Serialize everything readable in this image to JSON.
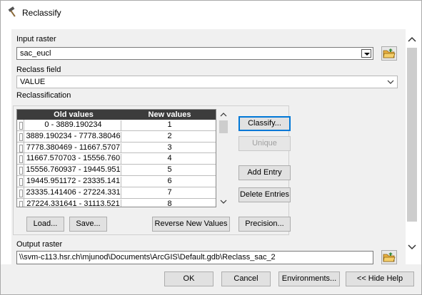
{
  "window": {
    "title": "Reclassify"
  },
  "input_raster": {
    "label": "Input raster",
    "value": "sac_eucl"
  },
  "reclass_field": {
    "label": "Reclass field",
    "value": "VALUE"
  },
  "reclassification": {
    "label": "Reclassification",
    "columns": [
      "Old values",
      "New values"
    ],
    "rows": [
      {
        "old": "0 - 3889.190234",
        "new": "1"
      },
      {
        "old": "3889.190234 - 7778.38046",
        "new": "2"
      },
      {
        "old": "7778.380469 - 11667.5707",
        "new": "3"
      },
      {
        "old": "11667.570703 - 15556.760",
        "new": "4"
      },
      {
        "old": "15556.760937 - 19445.951",
        "new": "5"
      },
      {
        "old": "19445.951172 - 23335.141",
        "new": "6"
      },
      {
        "old": "23335.141406 - 27224.331",
        "new": "7"
      },
      {
        "old": "27224.331641 - 31113.521",
        "new": "8"
      }
    ],
    "buttons": {
      "classify": "Classify...",
      "unique": "Unique",
      "add_entry": "Add Entry",
      "delete_entries": "Delete Entries",
      "load": "Load...",
      "save": "Save...",
      "reverse": "Reverse New Values",
      "precision": "Precision..."
    }
  },
  "output_raster": {
    "label": "Output raster",
    "value": "\\\\svm-c113.hsr.ch\\mjunod\\Documents\\ArcGIS\\Default.gdb\\Reclass_sac_2"
  },
  "footer": {
    "ok": "OK",
    "cancel": "Cancel",
    "environments": "Environments...",
    "hide_help": "<< Hide Help"
  },
  "icons": {
    "title": "hammer-icon",
    "folder": "folder-open-icon"
  }
}
